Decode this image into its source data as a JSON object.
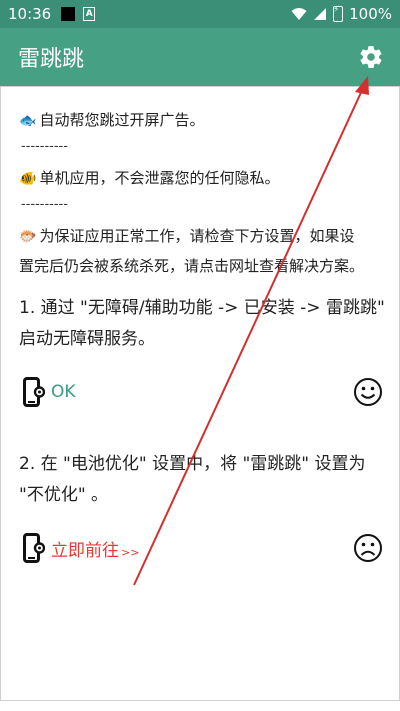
{
  "status_bar": {
    "time": "10:36",
    "notif_icon_letter": "A",
    "battery": "100%"
  },
  "app_bar": {
    "title": "雷跳跳",
    "settings_icon": "gear-icon"
  },
  "intro": {
    "line1": "自动帮您跳过开屏广告。",
    "sep1": "----------",
    "line2": "单机应用，不会泄露您的任何隐私。",
    "sep2": "----------",
    "line3a": "为保证应用正常工作，请检查下方设置，如果设",
    "line3b": "置完后仍会被系统杀死，请点击网址查看解决方案。"
  },
  "steps": [
    {
      "text_a": "1. 通过 \"无障碍/辅助功能 -> 已安装 -> 雷跳跳\"",
      "text_b": "启动无障碍服务。",
      "status_label": "OK",
      "status_icon": "smile-icon"
    },
    {
      "text_a": "2. 在 \"电池优化\" 设置中，将 \"雷跳跳\" 设置为",
      "text_b": "\"不优化\" 。",
      "status_label": "立即前往",
      "status_chevron": ">>",
      "status_icon": "frown-icon"
    }
  ],
  "colors": {
    "app_bar": "#46a083",
    "status_bar": "#3a8f76",
    "ok": "#3a9b86",
    "go": "#e53935",
    "annotation_arrow": "#d32f2f"
  }
}
